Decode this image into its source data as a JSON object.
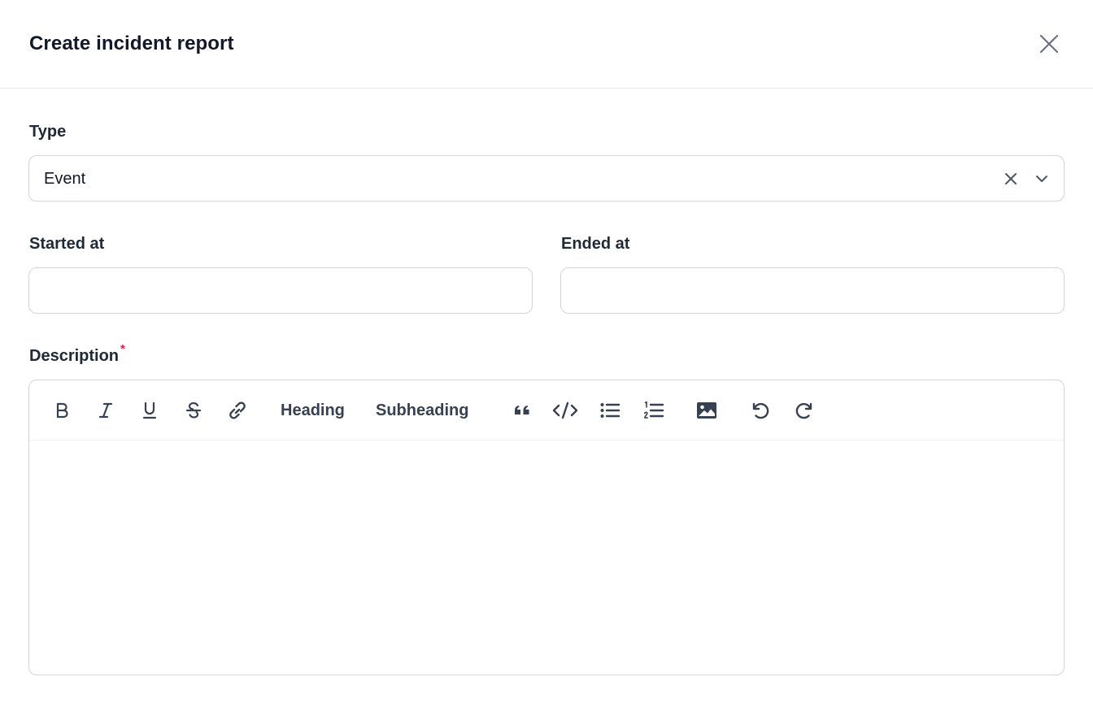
{
  "modal": {
    "title": "Create incident report"
  },
  "type_field": {
    "label": "Type",
    "value": "Event"
  },
  "started_field": {
    "label": "Started at",
    "value": "",
    "placeholder": ""
  },
  "ended_field": {
    "label": "Ended at",
    "value": "",
    "placeholder": ""
  },
  "description_field": {
    "label": "Description",
    "required_mark": "*",
    "content": ""
  },
  "toolbar": {
    "heading_label": "Heading",
    "subheading_label": "Subheading",
    "icons": [
      "bold-icon",
      "italic-icon",
      "underline-icon",
      "strikethrough-icon",
      "link-icon",
      "quote-icon",
      "code-icon",
      "bullet-list-icon",
      "numbered-list-icon",
      "image-icon",
      "undo-icon",
      "redo-icon"
    ]
  },
  "colors": {
    "border": "#d1d5db",
    "divider": "#e5e7eb",
    "text": "#111827",
    "icon": "#374151",
    "required": "#e11d48"
  }
}
